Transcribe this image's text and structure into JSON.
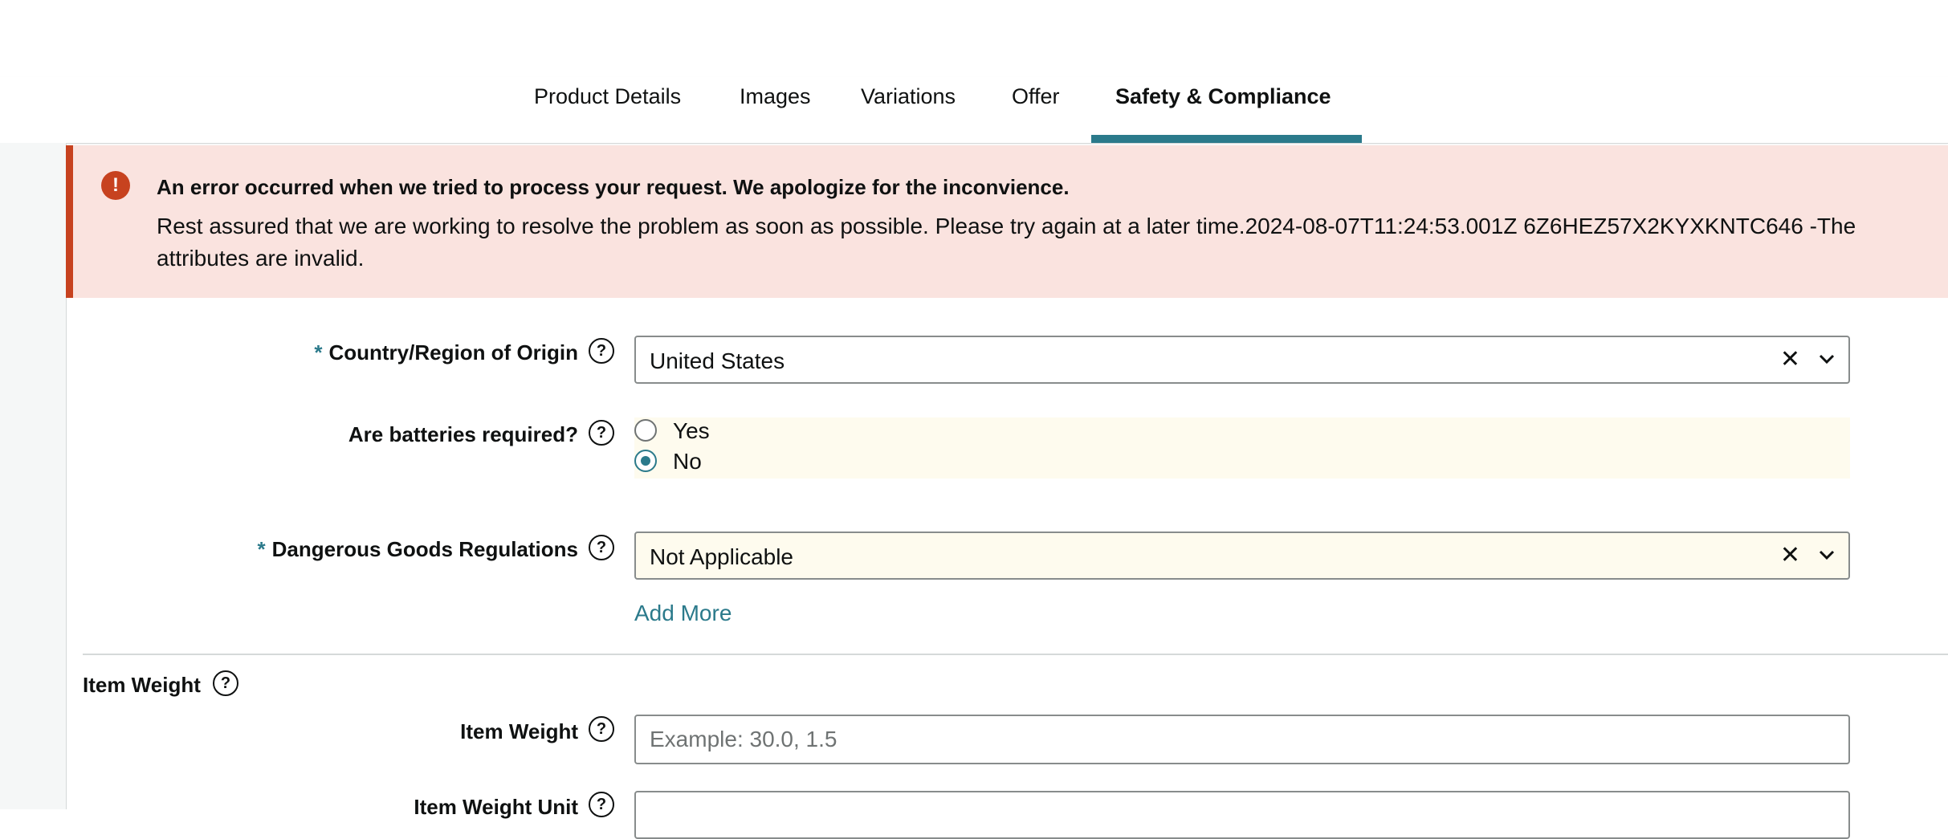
{
  "tabs": [
    {
      "label": "Product Details"
    },
    {
      "label": "Images"
    },
    {
      "label": "Variations"
    },
    {
      "label": "Offer"
    },
    {
      "label": "Safety & Compliance"
    }
  ],
  "active_tab": "Safety & Compliance",
  "error": {
    "title": "An error occurred when we tried to process your request. We apologize for the inconvience.",
    "body": "Rest assured that we are working to resolve the problem as soon as possible. Please try again at a later time.2024-08-07T11:24:53.001Z 6Z6HEZ57X2KYXKNTC646 -The attributes are invalid."
  },
  "form": {
    "required_mark": "*",
    "help_glyph": "?",
    "country": {
      "label": "Country/Region of Origin",
      "value": "United States"
    },
    "batteries": {
      "label": "Are batteries required?",
      "options": [
        "Yes",
        "No"
      ],
      "selected": "No"
    },
    "dangerous_goods": {
      "label": "Dangerous Goods Regulations",
      "value": "Not Applicable"
    },
    "add_more_label": "Add More",
    "item_weight_section": {
      "label": "Item Weight"
    },
    "item_weight": {
      "label": "Item Weight",
      "placeholder": "Example: 30.0, 1.5"
    },
    "item_weight_unit": {
      "label": "Item Weight Unit"
    }
  },
  "colors": {
    "accent": "#2b7a8b",
    "error": "#c7421f",
    "error_bg": "#fae3df",
    "highlight": "#fefbee"
  },
  "icons": {
    "clear": "close-icon",
    "dropdown": "chevron-down-icon",
    "help": "help-icon",
    "error": "alert-icon"
  }
}
